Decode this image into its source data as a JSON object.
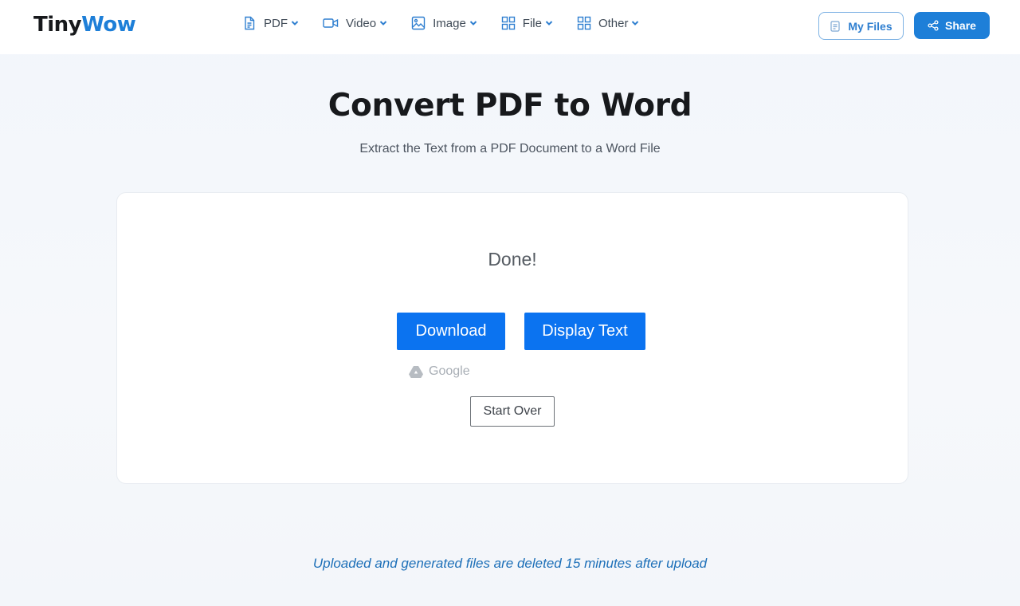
{
  "brand": {
    "part1": "Tiny",
    "part2": "Wow"
  },
  "nav": [
    {
      "label": "PDF",
      "icon": "document-icon"
    },
    {
      "label": "Video",
      "icon": "video-camera-icon"
    },
    {
      "label": "Image",
      "icon": "image-icon"
    },
    {
      "label": "File",
      "icon": "grid-icon"
    },
    {
      "label": "Other",
      "icon": "grid-icon"
    }
  ],
  "header": {
    "my_files_label": "My Files",
    "share_label": "Share"
  },
  "page": {
    "title": "Convert PDF to Word",
    "subtitle": "Extract the Text from a PDF Document to a Word File"
  },
  "result": {
    "status": "Done!",
    "download_label": "Download",
    "display_text_label": "Display Text",
    "gdrive_label": "Google",
    "start_over_label": "Start Over"
  },
  "footer": {
    "note": "Uploaded and generated files are deleted 15 minutes after upload"
  },
  "colors": {
    "accent": "#1e7fd8",
    "primary_button": "#0b73f0",
    "note_text": "#1d6fb8"
  }
}
